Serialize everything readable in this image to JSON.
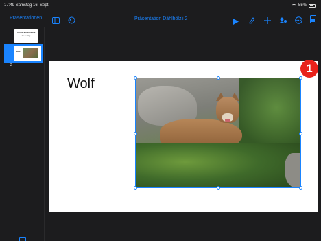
{
  "status_bar": {
    "time": "17:49",
    "date": "Samstag 16. Sept.",
    "battery": "55%"
  },
  "toolbar": {
    "back_label": "Präsentationen",
    "title": "Präsentation Dählhölzli 2",
    "icons": [
      "sidebar-icon",
      "undo-icon",
      "play-icon",
      "brush-icon",
      "plus-icon",
      "share-icon",
      "more-icon",
      "document-icon"
    ]
  },
  "sidebar": {
    "slides": [
      {
        "number": "1",
        "title": "Tierpark Dählhölzli",
        "subtitle": "Ein Ausflug"
      },
      {
        "number": "2",
        "title": "Wolf"
      }
    ]
  },
  "slide": {
    "title": "Wolf",
    "image_alt": "wolf"
  },
  "badge": {
    "label": "1"
  },
  "colors": {
    "accent": "#1a84ff",
    "badge": "#e8221b",
    "background": "#1c1c1e"
  }
}
